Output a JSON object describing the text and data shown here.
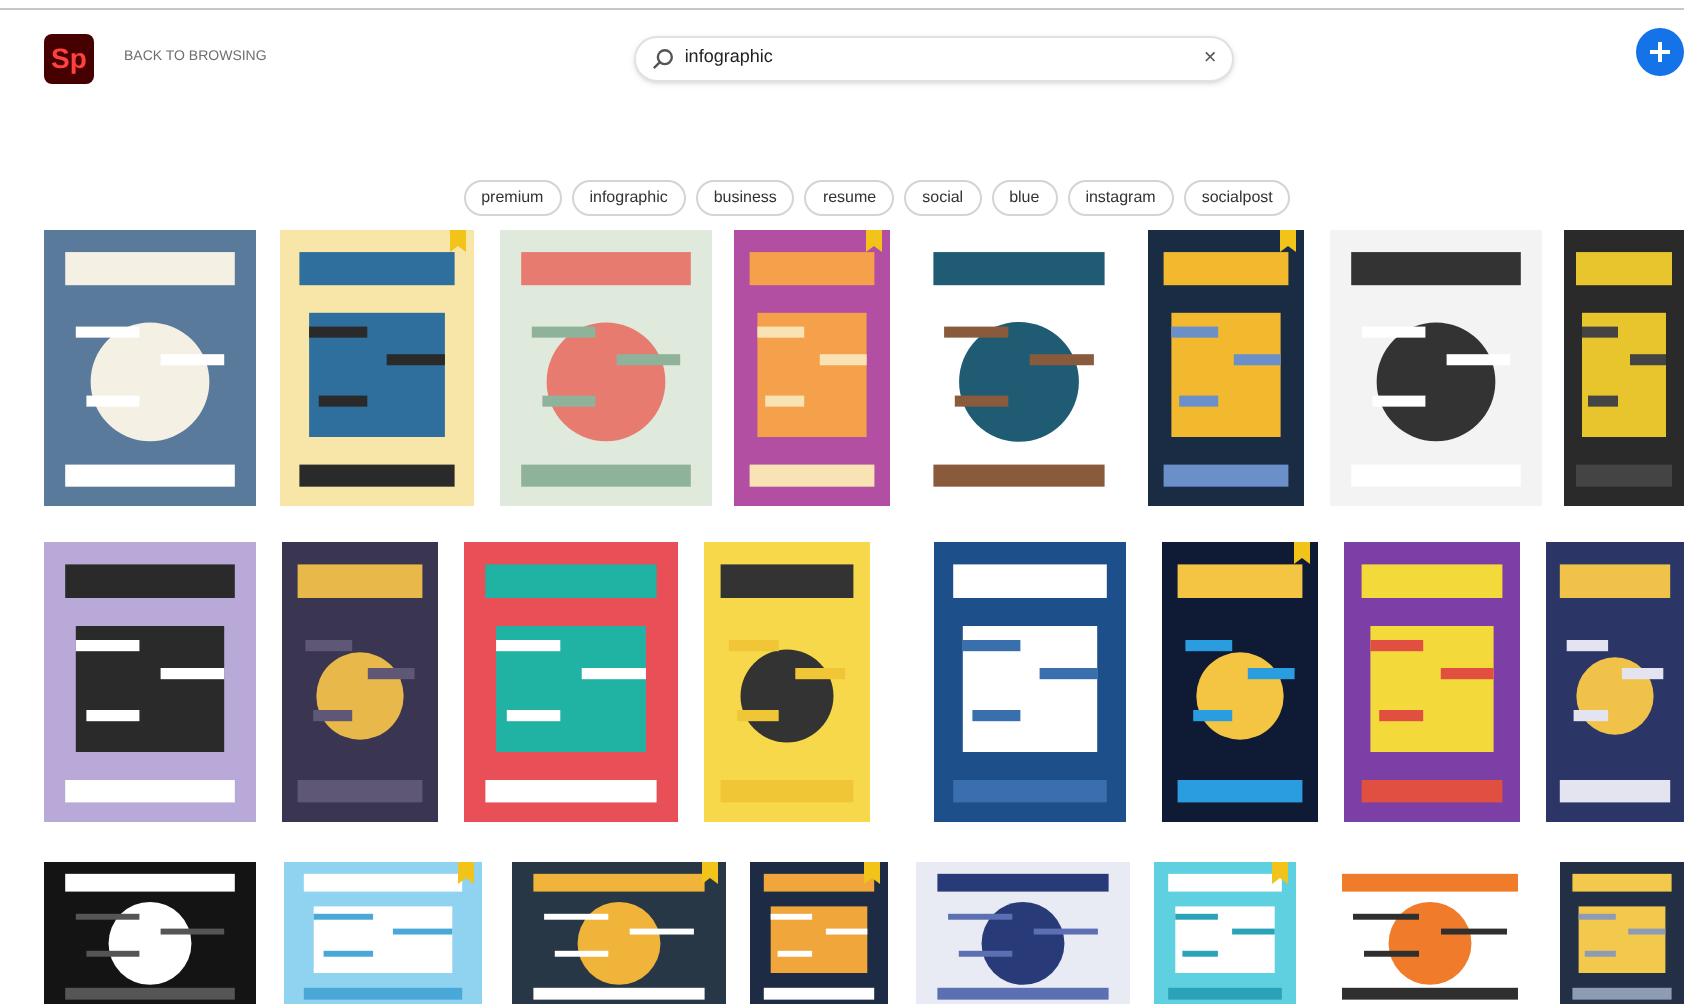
{
  "header": {
    "logo": "Sp",
    "back_link": "BACK TO BROWSING",
    "search": {
      "value": "infographic",
      "clear": "×"
    }
  },
  "tags": [
    {
      "label": "premium"
    },
    {
      "label": "infographic"
    },
    {
      "label": "business"
    },
    {
      "label": "resume"
    },
    {
      "label": "social"
    },
    {
      "label": "blue"
    },
    {
      "label": "instagram"
    },
    {
      "label": "socialpost"
    }
  ],
  "rows": [
    {
      "tiles": [
        {
          "kind": "picture",
          "premium": false
        },
        {
          "kind": "picture",
          "premium": true
        },
        {
          "kind": "picture",
          "premium": false
        },
        {
          "kind": "picture",
          "premium": true
        },
        {
          "kind": "picture",
          "premium": false
        },
        {
          "kind": "picture",
          "premium": true
        },
        {
          "kind": "picture",
          "premium": false
        },
        {
          "kind": "picture",
          "premium": false
        }
      ]
    },
    {
      "tiles": [
        {
          "kind": "picture",
          "premium": false
        },
        {
          "kind": "picture",
          "premium": false
        },
        {
          "kind": "picture",
          "premium": false
        },
        {
          "kind": "picture",
          "premium": false
        },
        {
          "kind": "picture",
          "premium": false
        },
        {
          "kind": "picture",
          "premium": true
        },
        {
          "kind": "picture",
          "premium": false
        },
        {
          "kind": "picture",
          "premium": false
        }
      ]
    },
    {
      "tiles": [
        {
          "kind": "picture",
          "premium": false
        },
        {
          "kind": "picture",
          "premium": true
        },
        {
          "kind": "picture",
          "premium": true
        },
        {
          "kind": "picture",
          "premium": true
        },
        {
          "kind": "picture",
          "premium": false
        },
        {
          "kind": "picture",
          "premium": true
        },
        {
          "kind": "picture",
          "premium": false
        },
        {
          "kind": "picture",
          "premium": false
        }
      ]
    }
  ]
}
